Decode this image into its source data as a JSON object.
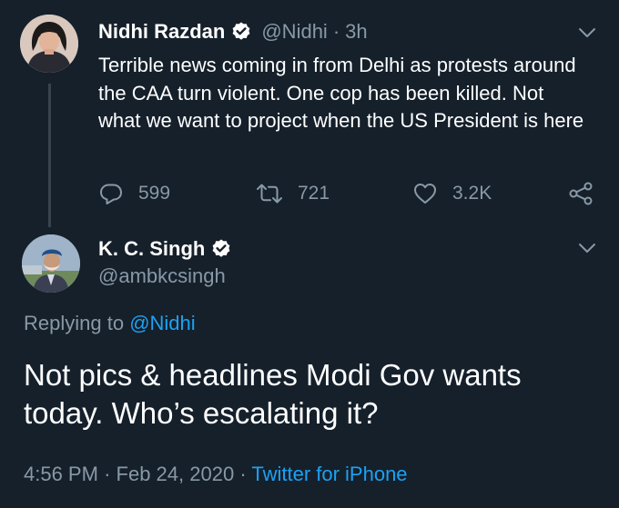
{
  "theme": {
    "background": "#15202b",
    "text_primary": "#ffffff",
    "text_secondary": "#8899a6",
    "accent": "#1da1f2"
  },
  "parent_tweet": {
    "display_name": "Nidhi Razdan",
    "verified": true,
    "handle": "@Nidhi",
    "separator": "·",
    "time": "3h",
    "text": "Terrible news coming in from Delhi as protests around the CAA turn violent. One cop has been killed. Not what we want to project when the US President is here",
    "actions": {
      "replies": "599",
      "retweets": "721",
      "likes": "3.2K",
      "reply_icon": "reply-icon",
      "retweet_icon": "retweet-icon",
      "like_icon": "heart-icon",
      "share_icon": "share-icon"
    }
  },
  "main_tweet": {
    "display_name": "K. C. Singh",
    "verified": true,
    "handle": "@ambkcsingh",
    "replying_prefix": "Replying to ",
    "replying_to": "@Nidhi",
    "text": "Not pics & headlines Modi Gov wants today. Who’s escalating it?",
    "time": "4:56 PM",
    "separator1": "·",
    "date": "Feb 24, 2020",
    "separator2": "·",
    "source": "Twitter for iPhone"
  }
}
